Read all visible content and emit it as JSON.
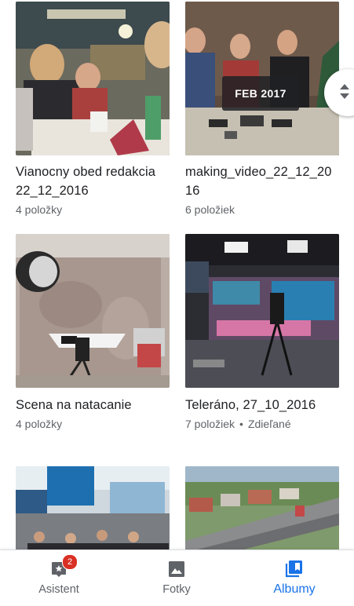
{
  "albums": [
    {
      "title_line1": "Vianocny obed redakcia",
      "title_line2": "22_12_2016",
      "count": "4 položky"
    },
    {
      "title_line1": "making_video_22_12_20",
      "title_line2": "16",
      "count": "6 položiek"
    },
    {
      "title_line1": "Scena na natacanie",
      "title_line2": "",
      "count": "4 položky"
    },
    {
      "title_line1": "Teleráno, 27_10_2016",
      "title_line2": "",
      "count": "7 položiek",
      "shared": "Zdieľané"
    }
  ],
  "scroll_date": "FEB 2017",
  "nav": {
    "assistant": {
      "label": "Asistent",
      "badge": "2"
    },
    "photos": {
      "label": "Fotky"
    },
    "albums": {
      "label": "Albumy",
      "active": true
    }
  },
  "colors": {
    "accent": "#1a73e8",
    "badge": "#d93025",
    "secondary_text": "#5f6368"
  }
}
